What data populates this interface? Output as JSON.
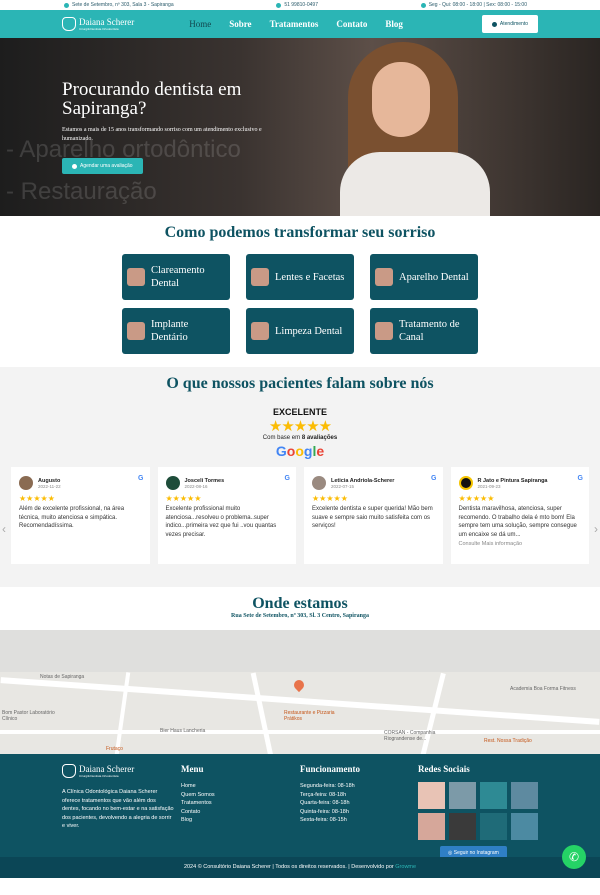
{
  "topbar": {
    "address": "Sete de Setembro, nº 303, Sala 3 - Sapiranga",
    "phone": "51 99810-0497",
    "hours": "Seg - Qui: 08:00 - 18:00 | Sex: 08:00 - 15:00"
  },
  "nav": {
    "logo_name": "Daiana Scherer",
    "logo_sub": "Cirurgiã Dentista Ortodontista",
    "items": [
      "Home",
      "Sobre",
      "Tratamentos",
      "Contato",
      "Blog"
    ],
    "cta": "Atendimento"
  },
  "hero": {
    "title": "Procurando dentista em Sapiranga?",
    "subtitle": "Estamos a mais de 15 anos transformando sorriso com um atendimento exclusivo e humanizado.",
    "cta": "Agendar uma avaliação",
    "bg_text_1": "- Aparelho ortodôntico",
    "bg_text_2": "- Restauração"
  },
  "services": {
    "title": "Como podemos transformar seu sorriso",
    "items": [
      "Clareamento Dental",
      "Lentes e Facetas",
      "Aparelho Dental",
      "Implante Dentário",
      "Limpeza Dental",
      "Tratamento de Canal"
    ]
  },
  "reviews": {
    "title": "O que nossos pacientes falam sobre nós",
    "rating_label": "EXCELENTE",
    "stars": "★★★★★",
    "based_prefix": "Com base em ",
    "based_count": "8 avaliações",
    "google": "Google",
    "cards": [
      {
        "name": "Augusto",
        "date": "2022-11-22",
        "text": "Além de excelente profissional, na área técnica, muito atenciosa e simpática. Recomendadíssima.",
        "more": ""
      },
      {
        "name": "Josceli Tormes",
        "date": "2022-08-16",
        "text": "Excelente profissional muito atenciosa...resolveu o problema..super indico...primeira vez que fui ..vou quantas vezes precisar.",
        "more": ""
      },
      {
        "name": "Leticia Andriola-Scherer",
        "date": "2022-07-15",
        "text": "Excelente dentista e super querida! Mão bem suave e sempre saio muito satisfeita com os serviços!",
        "more": ""
      },
      {
        "name": "R Jato e Pintura Sapiranga",
        "date": "2021-09-23",
        "text": "Dentista maravilhosa, atenciosa, super recomendo. O trabalho dela é mto bom! Ela sempre tem uma solução, sempre consegue um encaixe se dá um...",
        "more": "Consulte Mais informação"
      }
    ]
  },
  "location": {
    "title": "Onde estamos",
    "address": "Rua Sete de Setembro, nº 303, Sl. 3 Centro, Sapiranga"
  },
  "map": {
    "labels": [
      "Notas de Sapiranga",
      "Bom Pastor Laboratório Clínico",
      "Bier Haus Lancheria",
      "Restaurante e Pizzaria Prátikos",
      "Academia Boa Forma Fitness",
      "CORSAN - Companhia Riograndense de...",
      "Frutaço",
      "Rest. Nossa Tradição"
    ]
  },
  "footer": {
    "about": "A Clínica Odontológica Daiana Scherer oferece tratamentos que vão além dos dentes, focando no bem-estar e na satisfação dos pacientes, devolvendo a alegria de sorrir e viver.",
    "menu_title": "Menu",
    "menu": [
      "Home",
      "Quem Somos",
      "Tratamentos",
      "Contato",
      "Blog"
    ],
    "hours_title": "Funcionamento",
    "hours": [
      "Segunda-feira: 08-18h",
      "Terça-feira: 08-18h",
      "Quarta-feira: 08-18h",
      "Quinta-feira: 08-18h",
      "Sexta-feira: 08-15h"
    ],
    "social_title": "Redes Sociais",
    "insta_button": "Seguir no Instagram",
    "copyright": "2024 © Consultório Daiana Scherer | Todos os direitos reservados. | Desenvolvido por ",
    "dev": "Growme"
  },
  "colors": {
    "teal": "#2bb5b5",
    "dark_teal": "#0e5362",
    "star": "#fbbc04"
  }
}
